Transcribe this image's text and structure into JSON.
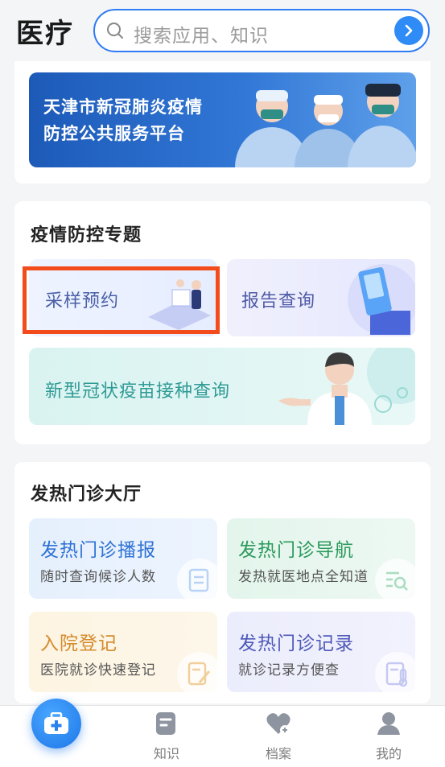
{
  "header": {
    "title": "医疗",
    "search_placeholder": "搜索应用、知识"
  },
  "banner": {
    "line1": "天津市新冠肺炎疫情",
    "line2": "防控公共服务平台"
  },
  "epidemic": {
    "title": "疫情防控专题",
    "tiles": [
      {
        "label": "采样预约"
      },
      {
        "label": "报告查询"
      },
      {
        "label": "新型冠状疫苗接种查询"
      }
    ]
  },
  "fever": {
    "title": "发热门诊大厅",
    "tiles": [
      {
        "label": "发热门诊播报",
        "sub": "随时查询候诊人数",
        "color": "#2f72d6"
      },
      {
        "label": "发热门诊导航",
        "sub": "发热就医地点全知道",
        "color": "#2c9a5c"
      },
      {
        "label": "入院登记",
        "sub": "医院就诊快速登记",
        "color": "#d58b2c"
      },
      {
        "label": "发热门诊记录",
        "sub": "就诊记录方便查",
        "color": "#4f59b9"
      }
    ]
  },
  "nav": {
    "items": [
      {
        "label": "知识",
        "icon": "knowledge-icon"
      },
      {
        "label": "档案",
        "icon": "heart-file-icon"
      },
      {
        "label": "我的",
        "icon": "user-icon"
      }
    ],
    "active_icon": "medical-kit-icon"
  },
  "colors": {
    "accent": "#2f7bf5",
    "highlight": "#f24b1c"
  }
}
